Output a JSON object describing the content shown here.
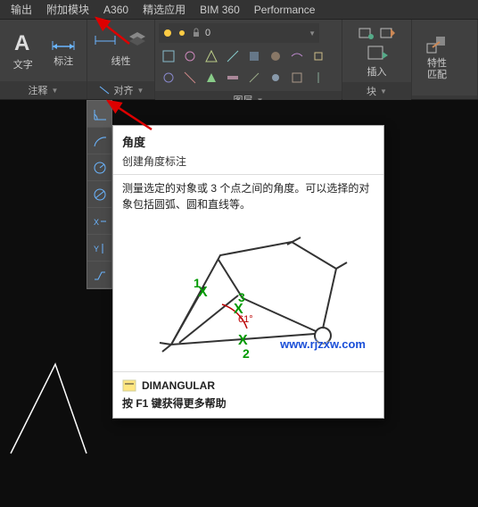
{
  "menu": {
    "items": [
      "输出",
      "附加模块",
      "A360",
      "精选应用",
      "BIM 360",
      "Performance"
    ]
  },
  "ribbon": {
    "text_label": "文字",
    "dim_label": "标注",
    "linear_label": "线性",
    "align_label": "对齐",
    "annot_title": "注释",
    "layer_title": "图层",
    "block_title": "块",
    "insert_label": "插入",
    "props_label": "特性\n匹配"
  },
  "tooltip": {
    "title": "角度",
    "subtitle": "创建角度标注",
    "description": "测量选定的对象或 3 个点之间的角度。可以选择的对象包括圆弧、圆和直线等。",
    "command": "DIMANGULAR",
    "help": "按 F1 键获得更多帮助",
    "url": "www.rjzxw.com",
    "pts": {
      "p1": "1",
      "p2": "2",
      "p3": "3",
      "ang": "61°"
    }
  }
}
